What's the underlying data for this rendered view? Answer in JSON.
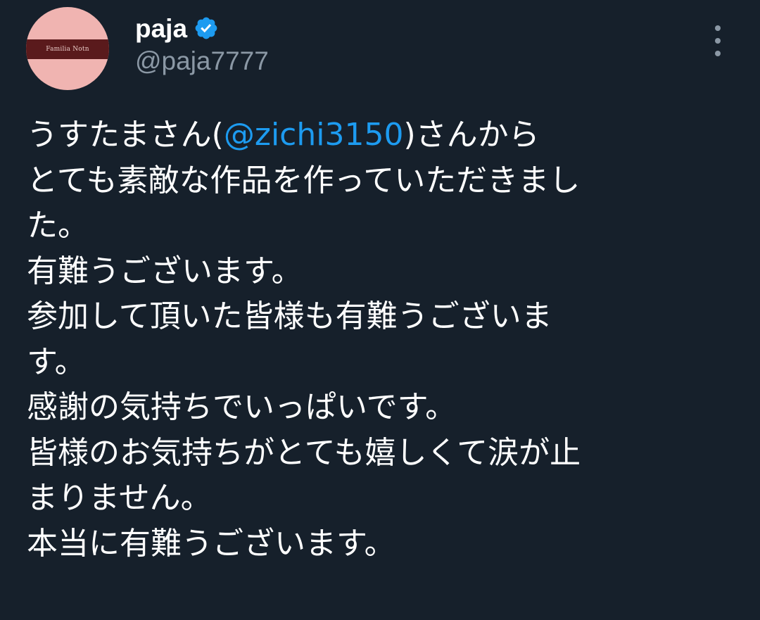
{
  "colors": {
    "background": "#16202b",
    "text_primary": "#ffffff",
    "text_secondary": "#8b98a5",
    "link": "#1d9bf0",
    "verified": "#1d9bf0",
    "avatar_bg": "#f0b4b1",
    "avatar_band": "#5a1a1c"
  },
  "author": {
    "avatar_text": "Familia Notn",
    "display_name": "paja",
    "verified_icon": "verified-badge-icon",
    "handle": "@paja7777"
  },
  "menu": {
    "icon": "more-vertical-icon"
  },
  "tweet": {
    "line1_before": "うすたまさん(",
    "mention": "@zichi3150",
    "line1_after": ")さんから",
    "lines": [
      "とても素敵な作品を作っていただきまし",
      "た。",
      "有難うございます。",
      "参加して頂いた皆様も有難うございま",
      "す。",
      "感謝の気持ちでいっぱいです。",
      "皆様のお気持ちがとても嬉しくて涙が止",
      "まりません。",
      "本当に有難うございます。"
    ]
  }
}
